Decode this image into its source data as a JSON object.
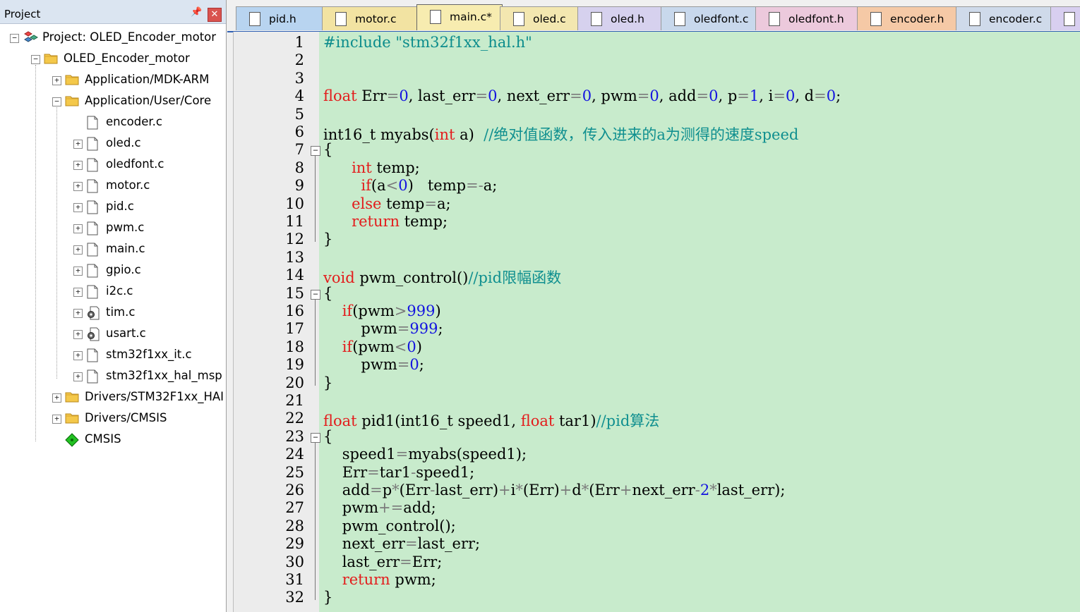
{
  "project_panel": {
    "title": "Project",
    "pin_icon": "pin-icon",
    "close_icon": "close-icon",
    "items": [
      {
        "label": "Project: OLED_Encoder_motor",
        "icon": "project-icon",
        "expander": "⊟"
      },
      {
        "label": "OLED_Encoder_motor",
        "icon": "target-folder-icon",
        "expander": "⊟"
      },
      {
        "label": "Application/MDK-ARM",
        "icon": "folder-icon",
        "expander": "+"
      },
      {
        "label": "Application/User/Core",
        "icon": "folder-open-icon",
        "expander": "−"
      },
      {
        "label": "encoder.c",
        "icon": "file-icon",
        "expander": ""
      },
      {
        "label": "oled.c",
        "icon": "file-icon",
        "expander": "+"
      },
      {
        "label": "oledfont.c",
        "icon": "file-icon",
        "expander": "+"
      },
      {
        "label": "motor.c",
        "icon": "file-icon",
        "expander": "+"
      },
      {
        "label": "pid.c",
        "icon": "file-icon",
        "expander": "+"
      },
      {
        "label": "pwm.c",
        "icon": "file-icon",
        "expander": "+"
      },
      {
        "label": "main.c",
        "icon": "file-icon",
        "expander": "+"
      },
      {
        "label": "gpio.c",
        "icon": "file-icon",
        "expander": "+"
      },
      {
        "label": "i2c.c",
        "icon": "file-icon",
        "expander": "+"
      },
      {
        "label": "tim.c",
        "icon": "gear-file-icon",
        "expander": "+"
      },
      {
        "label": "usart.c",
        "icon": "gear-file-icon",
        "expander": "+"
      },
      {
        "label": "stm32f1xx_it.c",
        "icon": "file-icon",
        "expander": "+"
      },
      {
        "label": "stm32f1xx_hal_msp",
        "icon": "file-icon",
        "expander": "+"
      },
      {
        "label": "Drivers/STM32F1xx_HAI",
        "icon": "folder-icon",
        "expander": "+"
      },
      {
        "label": "Drivers/CMSIS",
        "icon": "folder-icon",
        "expander": "+"
      },
      {
        "label": "CMSIS",
        "icon": "cmsis-diamond-icon",
        "expander": ""
      }
    ]
  },
  "tabs": [
    {
      "label": "pid.h",
      "color": "#b8d4f0",
      "active": false
    },
    {
      "label": "motor.c",
      "color": "#f2e3a2",
      "active": false
    },
    {
      "label": "main.c*",
      "color": "#f7ecb0",
      "active": true
    },
    {
      "label": "oled.c",
      "color": "#f3e7b0",
      "active": false
    },
    {
      "label": "oled.h",
      "color": "#d6d1ee",
      "active": false
    },
    {
      "label": "oledfont.c",
      "color": "#c8d8ec",
      "active": false
    },
    {
      "label": "oledfont.h",
      "color": "#ecc9dc",
      "active": false
    },
    {
      "label": "encoder.h",
      "color": "#f5c9a6",
      "active": false
    },
    {
      "label": "encoder.c",
      "color": "#cfdaea",
      "active": false
    },
    {
      "label": "",
      "color": "#d8cff0",
      "active": false
    }
  ],
  "editor": {
    "line_numbers": [
      "1",
      "2",
      "3",
      "4",
      "5",
      "6",
      "7",
      "8",
      "9",
      "10",
      "11",
      "12",
      "13",
      "14",
      "15",
      "16",
      "17",
      "18",
      "19",
      "20",
      "21",
      "22",
      "23",
      "24",
      "25",
      "26",
      "27",
      "28",
      "29",
      "30",
      "31",
      "32"
    ],
    "lines": [
      [
        {
          "t": "pp",
          "s": "#include \"stm32f1xx_hal.h\""
        }
      ],
      [],
      [],
      [
        {
          "t": "kw",
          "s": "float"
        },
        {
          "t": "",
          "s": " Err"
        },
        {
          "t": "op",
          "s": "="
        },
        {
          "t": "num",
          "s": "0"
        },
        {
          "t": "",
          "s": ", last_err"
        },
        {
          "t": "op",
          "s": "="
        },
        {
          "t": "num",
          "s": "0"
        },
        {
          "t": "",
          "s": ", next_err"
        },
        {
          "t": "op",
          "s": "="
        },
        {
          "t": "num",
          "s": "0"
        },
        {
          "t": "",
          "s": ", pwm"
        },
        {
          "t": "op",
          "s": "="
        },
        {
          "t": "num",
          "s": "0"
        },
        {
          "t": "",
          "s": ", add"
        },
        {
          "t": "op",
          "s": "="
        },
        {
          "t": "num",
          "s": "0"
        },
        {
          "t": "",
          "s": ", p"
        },
        {
          "t": "op",
          "s": "="
        },
        {
          "t": "num",
          "s": "1"
        },
        {
          "t": "",
          "s": ", i"
        },
        {
          "t": "op",
          "s": "="
        },
        {
          "t": "num",
          "s": "0"
        },
        {
          "t": "",
          "s": ", d"
        },
        {
          "t": "op",
          "s": "="
        },
        {
          "t": "num",
          "s": "0"
        },
        {
          "t": "",
          "s": ";"
        }
      ],
      [],
      [
        {
          "t": "",
          "s": "int16_t myabs("
        },
        {
          "t": "kw",
          "s": "int"
        },
        {
          "t": "",
          "s": " a)  "
        },
        {
          "t": "cm",
          "s": "//绝对值函数，传入进来的a为测得的速度speed"
        }
      ],
      [
        {
          "t": "",
          "s": "{"
        }
      ],
      [
        {
          "t": "",
          "s": "      "
        },
        {
          "t": "kw",
          "s": "int"
        },
        {
          "t": "",
          "s": " temp;"
        }
      ],
      [
        {
          "t": "",
          "s": "        "
        },
        {
          "t": "kw",
          "s": "if"
        },
        {
          "t": "",
          "s": "(a"
        },
        {
          "t": "op",
          "s": "<"
        },
        {
          "t": "num",
          "s": "0"
        },
        {
          "t": "",
          "s": ")   temp"
        },
        {
          "t": "op",
          "s": "=-"
        },
        {
          "t": "",
          "s": "a;"
        }
      ],
      [
        {
          "t": "",
          "s": "      "
        },
        {
          "t": "kw",
          "s": "else"
        },
        {
          "t": "",
          "s": " temp"
        },
        {
          "t": "op",
          "s": "="
        },
        {
          "t": "",
          "s": "a;"
        }
      ],
      [
        {
          "t": "",
          "s": "      "
        },
        {
          "t": "kw",
          "s": "return"
        },
        {
          "t": "",
          "s": " temp;"
        }
      ],
      [
        {
          "t": "",
          "s": "}"
        }
      ],
      [],
      [
        {
          "t": "kw",
          "s": "void"
        },
        {
          "t": "",
          "s": " pwm_control()"
        },
        {
          "t": "cm",
          "s": "//pid限幅函数"
        }
      ],
      [
        {
          "t": "",
          "s": "{"
        }
      ],
      [
        {
          "t": "",
          "s": "    "
        },
        {
          "t": "kw",
          "s": "if"
        },
        {
          "t": "",
          "s": "(pwm"
        },
        {
          "t": "op",
          "s": ">"
        },
        {
          "t": "num",
          "s": "999"
        },
        {
          "t": "",
          "s": ")"
        }
      ],
      [
        {
          "t": "",
          "s": "        pwm"
        },
        {
          "t": "op",
          "s": "="
        },
        {
          "t": "num",
          "s": "999"
        },
        {
          "t": "",
          "s": ";"
        }
      ],
      [
        {
          "t": "",
          "s": "    "
        },
        {
          "t": "kw",
          "s": "if"
        },
        {
          "t": "",
          "s": "(pwm"
        },
        {
          "t": "op",
          "s": "<"
        },
        {
          "t": "num",
          "s": "0"
        },
        {
          "t": "",
          "s": ")"
        }
      ],
      [
        {
          "t": "",
          "s": "        pwm"
        },
        {
          "t": "op",
          "s": "="
        },
        {
          "t": "num",
          "s": "0"
        },
        {
          "t": "",
          "s": ";"
        }
      ],
      [
        {
          "t": "",
          "s": "}"
        }
      ],
      [],
      [
        {
          "t": "kw",
          "s": "float"
        },
        {
          "t": "",
          "s": " pid1(int16_t speed1, "
        },
        {
          "t": "kw",
          "s": "float"
        },
        {
          "t": "",
          "s": " tar1)"
        },
        {
          "t": "cm",
          "s": "//pid算法"
        }
      ],
      [
        {
          "t": "",
          "s": "{"
        }
      ],
      [
        {
          "t": "",
          "s": "    speed1"
        },
        {
          "t": "op",
          "s": "="
        },
        {
          "t": "",
          "s": "myabs(speed1);"
        }
      ],
      [
        {
          "t": "",
          "s": "    Err"
        },
        {
          "t": "op",
          "s": "="
        },
        {
          "t": "",
          "s": "tar1"
        },
        {
          "t": "op",
          "s": "-"
        },
        {
          "t": "",
          "s": "speed1;"
        }
      ],
      [
        {
          "t": "",
          "s": "    add"
        },
        {
          "t": "op",
          "s": "="
        },
        {
          "t": "",
          "s": "p"
        },
        {
          "t": "op",
          "s": "*"
        },
        {
          "t": "",
          "s": "(Err"
        },
        {
          "t": "op",
          "s": "-"
        },
        {
          "t": "",
          "s": "last_err)"
        },
        {
          "t": "op",
          "s": "+"
        },
        {
          "t": "",
          "s": "i"
        },
        {
          "t": "op",
          "s": "*"
        },
        {
          "t": "",
          "s": "(Err)"
        },
        {
          "t": "op",
          "s": "+"
        },
        {
          "t": "",
          "s": "d"
        },
        {
          "t": "op",
          "s": "*"
        },
        {
          "t": "",
          "s": "(Err"
        },
        {
          "t": "op",
          "s": "+"
        },
        {
          "t": "",
          "s": "next_err"
        },
        {
          "t": "op",
          "s": "-"
        },
        {
          "t": "num",
          "s": "2"
        },
        {
          "t": "op",
          "s": "*"
        },
        {
          "t": "",
          "s": "last_err);"
        }
      ],
      [
        {
          "t": "",
          "s": "    pwm"
        },
        {
          "t": "op",
          "s": "+="
        },
        {
          "t": "",
          "s": "add;"
        }
      ],
      [
        {
          "t": "",
          "s": "    pwm_control();"
        }
      ],
      [
        {
          "t": "",
          "s": "    next_err"
        },
        {
          "t": "op",
          "s": "="
        },
        {
          "t": "",
          "s": "last_err;"
        }
      ],
      [
        {
          "t": "",
          "s": "    last_err"
        },
        {
          "t": "op",
          "s": "="
        },
        {
          "t": "",
          "s": "Err;"
        }
      ],
      [
        {
          "t": "",
          "s": "    "
        },
        {
          "t": "kw",
          "s": "return"
        },
        {
          "t": "",
          "s": " pwm;"
        }
      ],
      [
        {
          "t": "",
          "s": "}"
        }
      ]
    ],
    "fold_marker": "−"
  },
  "colors": {
    "editor_bg": "#c8ebcc",
    "keyword": "#e31c1c",
    "number": "#1414e0",
    "comment": "#0f8f8f"
  }
}
